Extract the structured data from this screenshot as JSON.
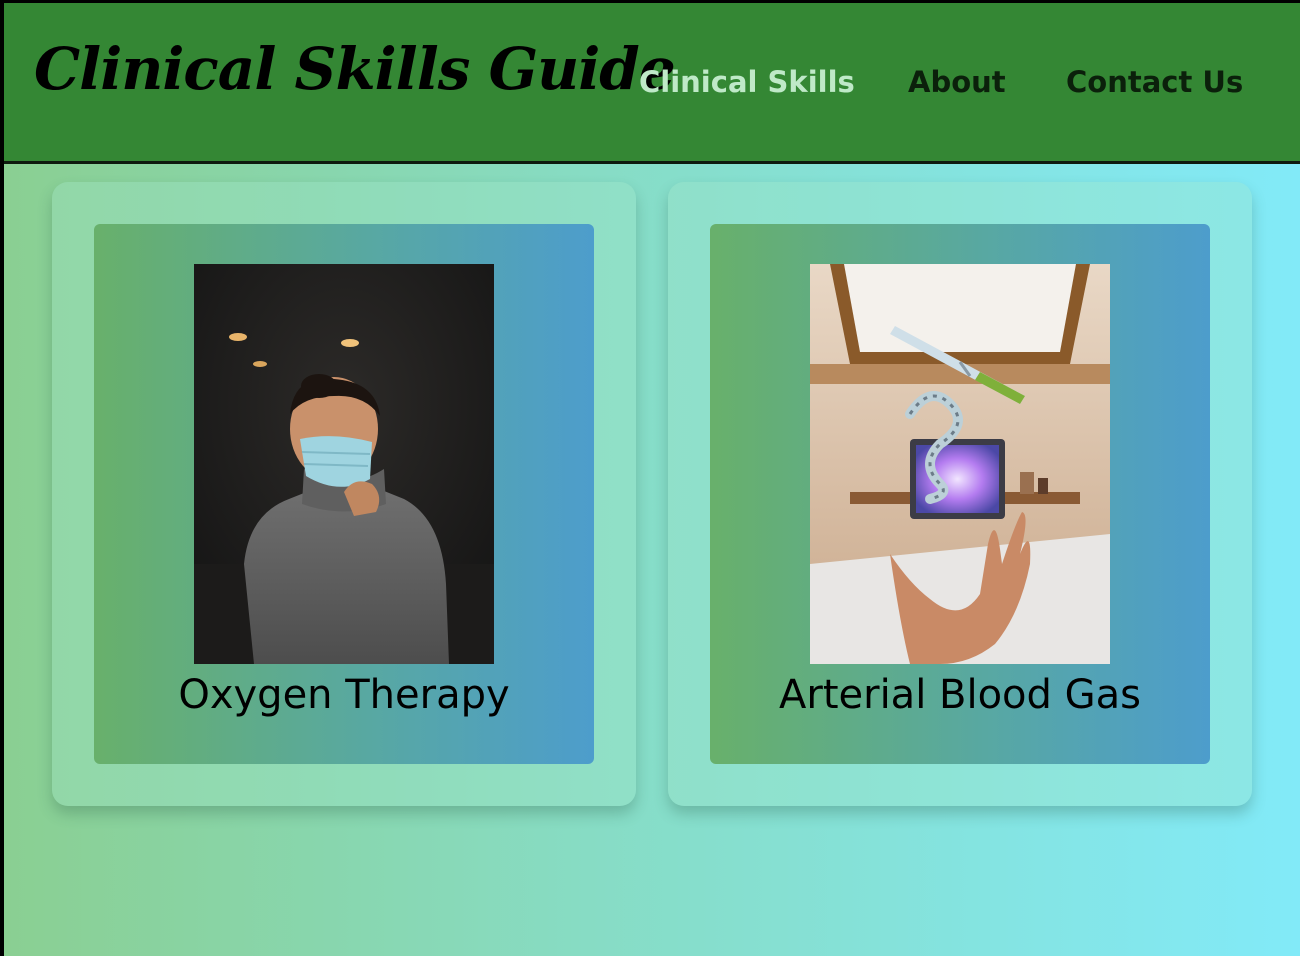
{
  "header": {
    "logo": "Clinical Skills Guide",
    "nav": [
      {
        "label": "Clinical Skills",
        "active": true
      },
      {
        "label": "About",
        "active": false
      },
      {
        "label": "Contact Us",
        "active": false
      }
    ]
  },
  "cards": [
    {
      "title": "Oxygen Therapy",
      "image": "woman-wearing-face-mask-photo"
    },
    {
      "title": "Arterial Blood Gas",
      "image": "syringe-floating-above-hand-photo"
    }
  ],
  "colors": {
    "header_bg": "#348734",
    "active_nav": "#bfe9c8",
    "nav_text": "#0b200b",
    "page_gradient_start": "#8acf92",
    "page_gradient_end": "#82eaf8"
  }
}
